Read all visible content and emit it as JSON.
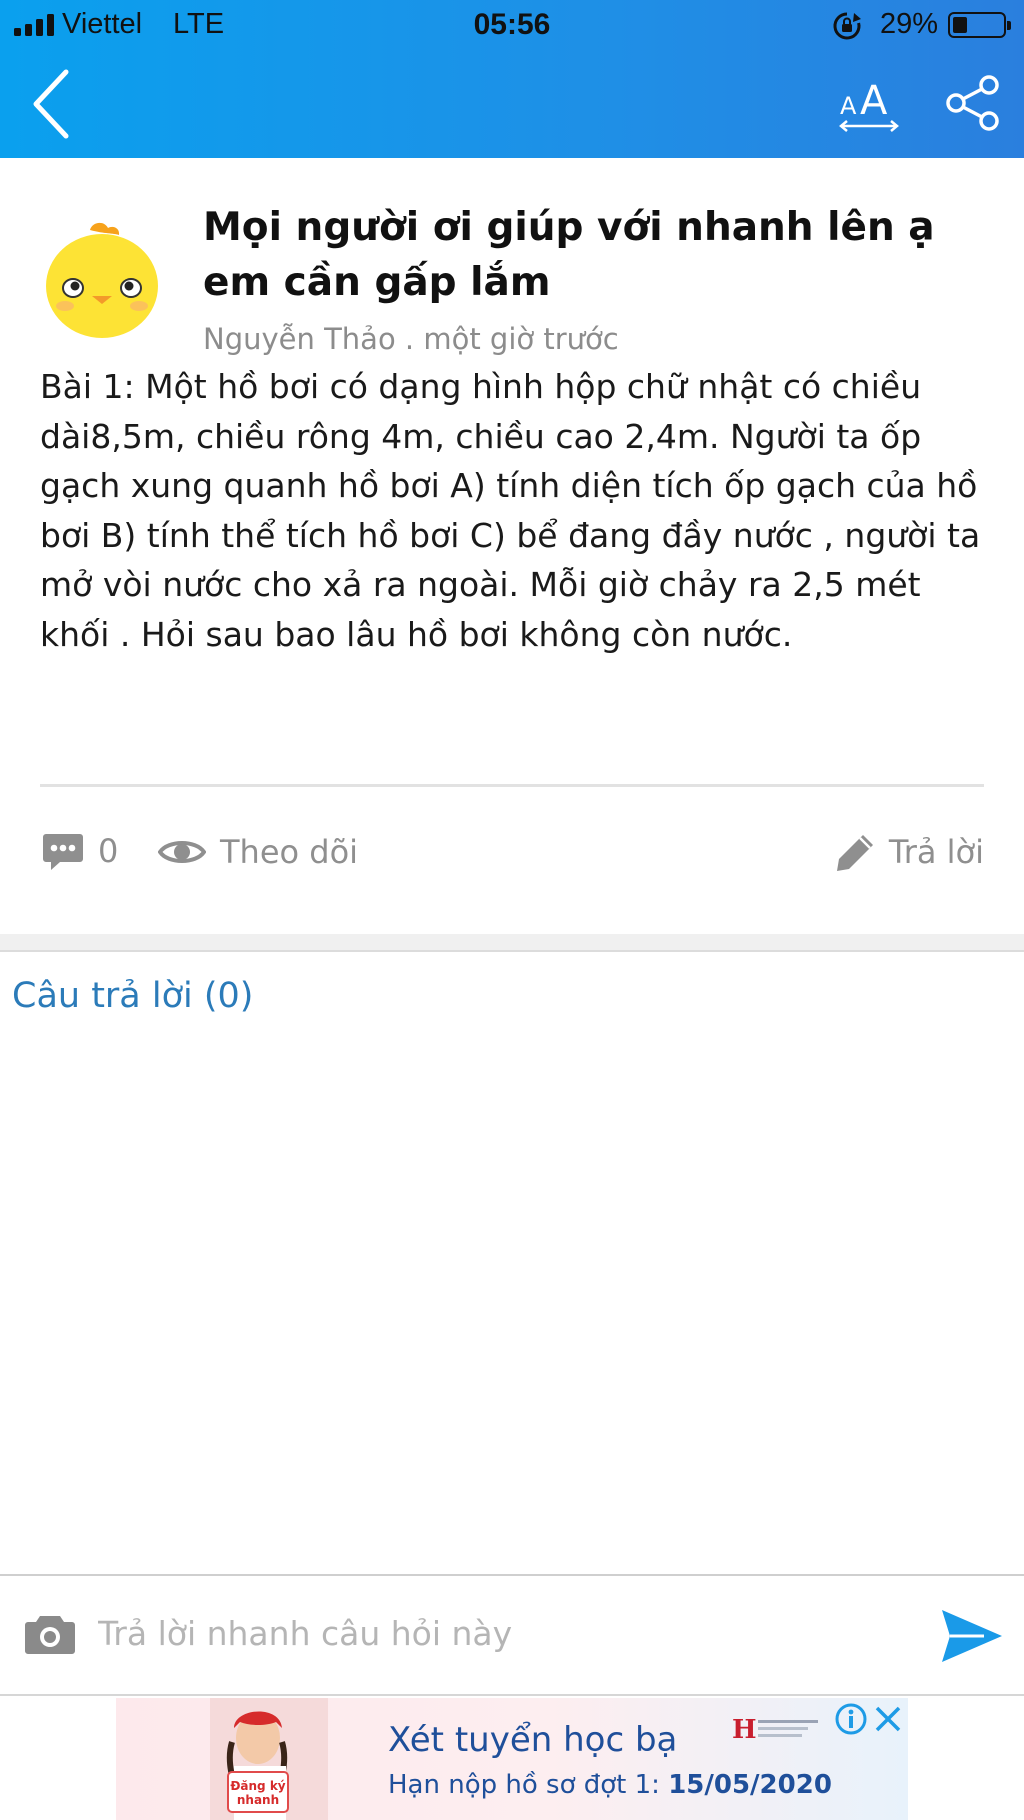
{
  "status_bar": {
    "carrier": "Viettel",
    "network": "LTE",
    "time": "05:56",
    "battery_percent": "29%",
    "battery_level": 0.29
  },
  "header": {
    "back_icon": "chevron-left-icon",
    "font_size_icon": "font-size-icon",
    "share_icon": "share-icon",
    "color": "#1a95ea"
  },
  "question": {
    "title": "Mọi người ơi giúp với nhanh lên ạ em cần gấp lắm",
    "author": "Nguyễn Thảo",
    "time": "một giờ trước",
    "meta": "Nguyễn Thảo . một giờ trước",
    "body": "Bài 1: Một hồ bơi có dạng hình hộp chữ nhật có chiều dài8,5m, chiều rông 4m, chiều cao 2,4m. Người ta ốp gạch xung quanh hồ bơi A) tính diện tích ốp gạch của hồ bơi B) tính thể tích hồ bơi C) bể đang đầy nước , người ta mở vòi nước cho xả ra ngoài. Mỗi giờ chảy ra 2,5 mét khối . Hỏi sau bao lâu hồ bơi không còn nước."
  },
  "actions": {
    "comment_count": "0",
    "follow_label": "Theo dõi",
    "reply_label": "Trả lời"
  },
  "answers": {
    "heading": "Câu trả lời (0)"
  },
  "quick_reply": {
    "placeholder": "Trả lời nhanh câu hỏi này"
  },
  "ad": {
    "title": "Xét tuyển học bạ",
    "subtitle_prefix": "Hạn nộp hồ sơ đợt 1: ",
    "subtitle_date": "15/05/2020",
    "badge_text": "Đăng ký nhanh",
    "logo_letter": "H",
    "info_icon": "info-icon",
    "close_icon": "close-icon"
  },
  "colors": {
    "accent": "#2b7bb9",
    "send": "#1a9ae8",
    "muted": "#8f8f8f"
  }
}
